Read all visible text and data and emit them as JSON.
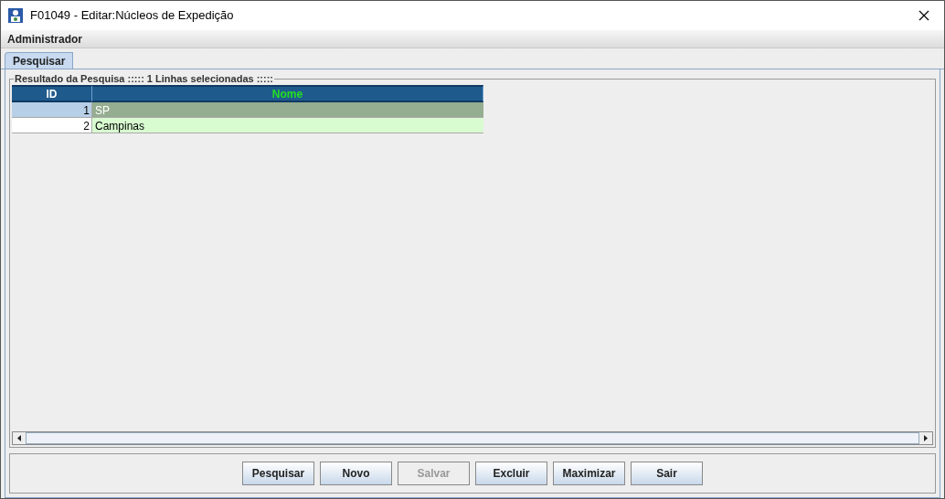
{
  "window": {
    "title": "F01049 - Editar:Núcleos de Expedição"
  },
  "user": "Administrador",
  "tabs": [
    {
      "label": "Pesquisar",
      "selected": true
    }
  ],
  "results": {
    "title": "Resultado da Pesquisa ::::: 1 Linhas selecionadas :::::",
    "columns": [
      "ID",
      "Nome"
    ],
    "rows": [
      {
        "id": "1",
        "nome": "SP",
        "selected": true
      },
      {
        "id": "2",
        "nome": "Campinas",
        "selected": false
      }
    ]
  },
  "buttons": [
    {
      "label": "Pesquisar",
      "disabled": false
    },
    {
      "label": "Novo",
      "disabled": false
    },
    {
      "label": "Salvar",
      "disabled": true
    },
    {
      "label": "Excluir",
      "disabled": false
    },
    {
      "label": "Maximizar",
      "disabled": false
    },
    {
      "label": "Sair",
      "disabled": false
    }
  ]
}
